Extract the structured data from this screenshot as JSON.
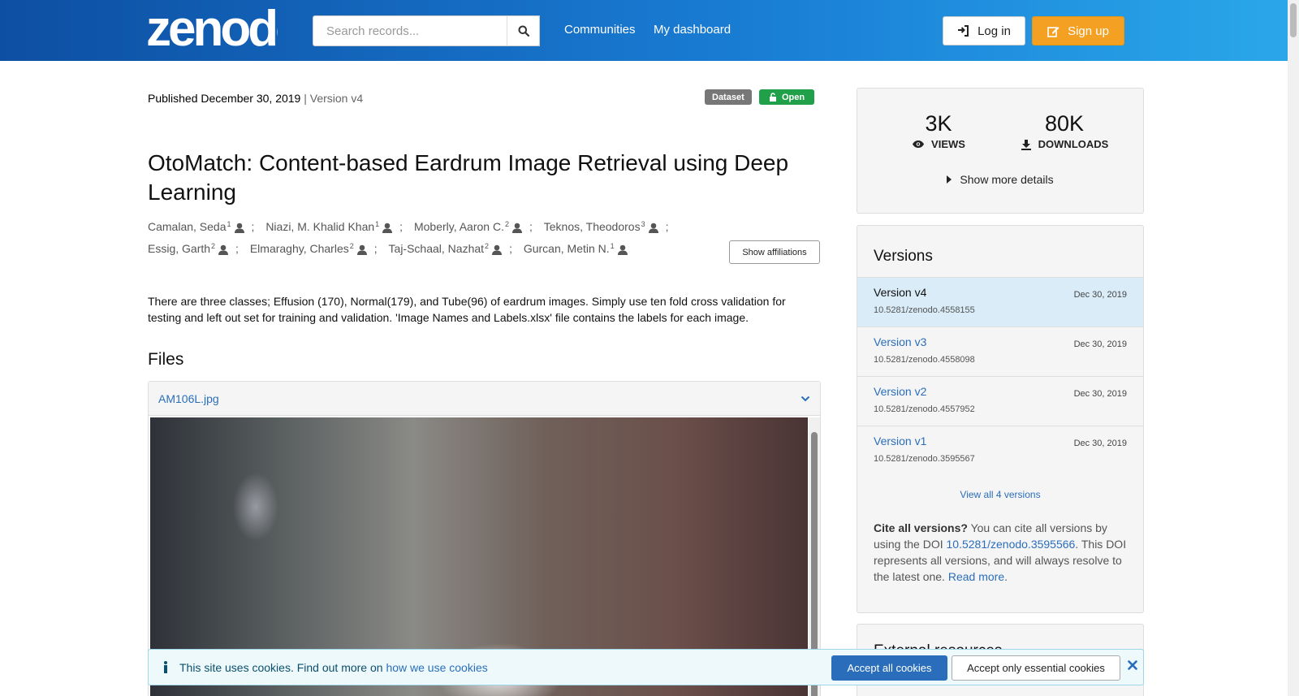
{
  "header": {
    "logo_text": "zenodo",
    "search_placeholder": "Search records...",
    "nav": [
      "Communities",
      "My dashboard"
    ],
    "login_label": "Log in",
    "signup_label": "Sign up"
  },
  "record": {
    "published_label": "Published December 30, 2019",
    "version_label": "| Version v4",
    "badges": {
      "type": "Dataset",
      "access": "Open"
    },
    "title": "OtoMatch: Content-based Eardrum Image Retrieval using Deep Learning",
    "authors": [
      {
        "name": "Camalan, Seda",
        "aff": "1"
      },
      {
        "name": "Niazi, M. Khalid Khan",
        "aff": "1"
      },
      {
        "name": "Moberly, Aaron C.",
        "aff": "2"
      },
      {
        "name": "Teknos, Theodoros",
        "aff": "3"
      },
      {
        "name": "Essig, Garth",
        "aff": "2"
      },
      {
        "name": "Elmaraghy, Charles",
        "aff": "2"
      },
      {
        "name": "Taj-Schaal, Nazhat",
        "aff": "2"
      },
      {
        "name": "Gurcan, Metin N.",
        "aff": "1"
      }
    ],
    "show_affiliations_label": "Show affiliations",
    "description": "There are three classes; Effusion (170), Normal(179), and Tube(96) of eardrum  images. Simply use ten fold cross validation for testing and left out set for training and validation. 'Image Names and Labels.xlsx' file contains the labels for each image.",
    "files_heading": "Files",
    "file_name": "AM106L.jpg"
  },
  "stats": {
    "views": "3K",
    "views_label": "VIEWS",
    "downloads": "80K",
    "downloads_label": "DOWNLOADS",
    "show_more_label": "Show more details"
  },
  "versions": {
    "heading": "Versions",
    "items": [
      {
        "title": "Version v4",
        "date": "Dec 30, 2019",
        "doi": "10.5281/zenodo.4558155"
      },
      {
        "title": "Version v3",
        "date": "Dec 30, 2019",
        "doi": "10.5281/zenodo.4558098"
      },
      {
        "title": "Version v2",
        "date": "Dec 30, 2019",
        "doi": "10.5281/zenodo.4557952"
      },
      {
        "title": "Version v1",
        "date": "Dec 30, 2019",
        "doi": "10.5281/zenodo.3595567"
      }
    ],
    "view_all_label": "View all 4 versions",
    "cite_bold": "Cite all versions?",
    "cite_text1": " You can cite all versions by using the DOI ",
    "cite_doi": "10.5281/zenodo.3595566",
    "cite_text2": ". This DOI represents all versions, and will always resolve to the latest one. ",
    "cite_read_more": "Read more",
    "cite_period": "."
  },
  "external": {
    "heading": "External resources"
  },
  "cookie": {
    "text": "This site uses cookies. Find out more on ",
    "link": "how we use cookies",
    "accept_all": "Accept all cookies",
    "accept_essential": "Accept only essential cookies"
  },
  "colors": {
    "header_start": "#0d4fa3",
    "header_end": "#2aa8ea",
    "signup": "#f3a023",
    "open_badge": "#21a04a",
    "link": "#2a6ebb"
  }
}
